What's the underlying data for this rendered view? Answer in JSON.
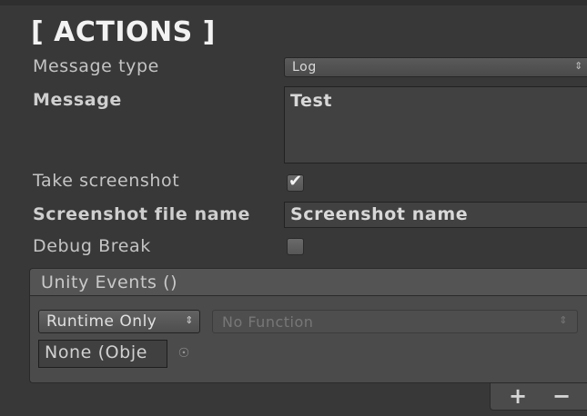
{
  "header": {
    "title": "[ ACTIONS ]"
  },
  "fields": {
    "message_type_label": "Message type",
    "message_type_value": "Log",
    "message_label": "Message",
    "message_value": "Test",
    "take_screenshot_label": "Take screenshot",
    "take_screenshot_checked": true,
    "screenshot_file_name_label": "Screenshot file name",
    "screenshot_file_name_value": "Screenshot name",
    "debug_break_label": "Debug Break",
    "debug_break_checked": false
  },
  "unity_events": {
    "title": "Unity Events ()",
    "runtime_value": "Runtime Only",
    "function_value": "No Function",
    "object_value": "None (Obje",
    "add_label": "+",
    "remove_label": "−"
  },
  "icons": {
    "dropdown": "up-down-arrows-icon",
    "checkmark": "checkmark-icon",
    "object_picker": "object-picker-icon"
  },
  "colors": {
    "background": "#383838",
    "panel": "#4b4b4b",
    "text": "#c4c4c4"
  }
}
